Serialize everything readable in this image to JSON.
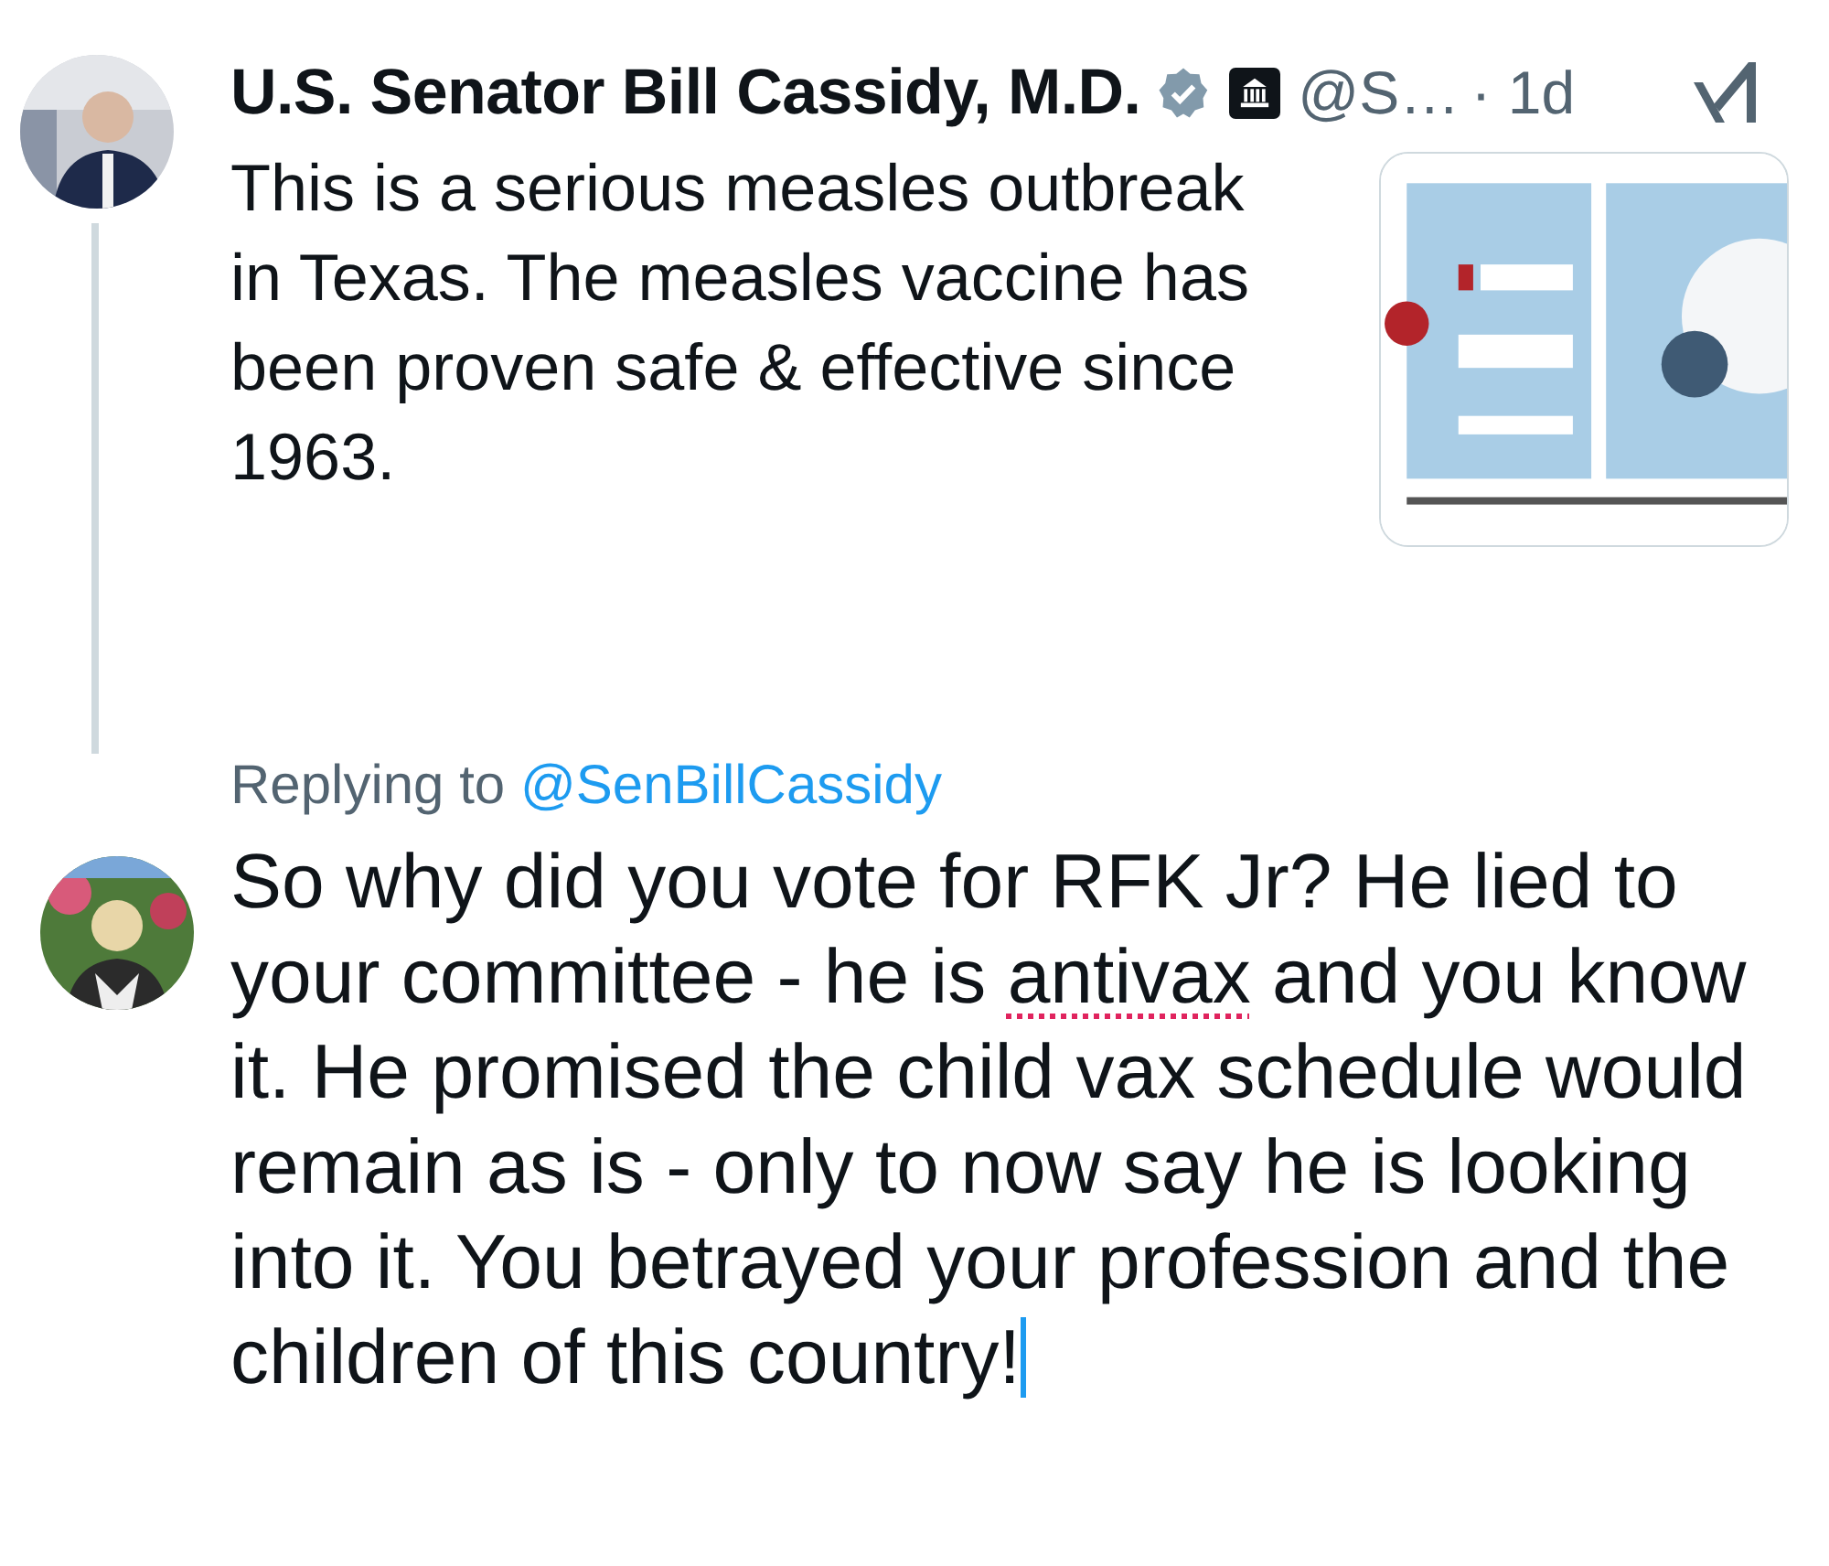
{
  "original_tweet": {
    "author_name": "U.S. Senator Bill Cassidy, M.D.",
    "verified": true,
    "government_badge": true,
    "handle": "@S…",
    "time": "· 1d",
    "text": "This is a serious measles outbreak in Texas. The measles vaccine has been proven safe & effective since 1963."
  },
  "reply": {
    "replying_to_label": "Replying to",
    "replying_to_handle": "@SenBillCassidy",
    "segments": [
      {
        "text": "So why did you vote for RFK Jr? He lied to your committee - he is ",
        "misspelled": false
      },
      {
        "text": "antivax",
        "misspelled": true
      },
      {
        "text": " and you know it. He promised the child vax schedule would remain as is - only to now say he is looking into it. You betrayed your profession and the children of this country!",
        "misspelled": false
      }
    ],
    "cursor": true
  }
}
